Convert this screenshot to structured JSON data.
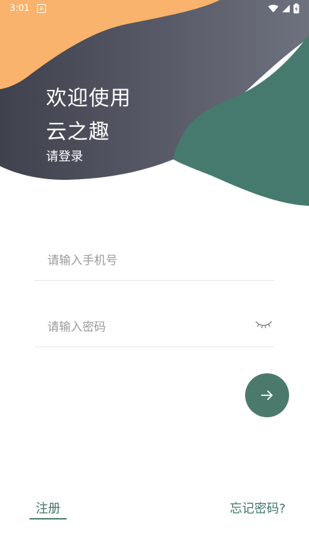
{
  "status_bar": {
    "time": "3:01",
    "notification_icon": "A",
    "icons": [
      "wifi-icon",
      "signal-icon",
      "battery-icon"
    ]
  },
  "header": {
    "welcome_line1": "欢迎使用",
    "welcome_line2": "云之趣",
    "subtitle": "请登录"
  },
  "form": {
    "phone_placeholder": "请输入手机号",
    "password_placeholder": "请输入密码",
    "password_visibility_icon": "eye-closed-icon",
    "submit_icon": "arrow-right-icon"
  },
  "footer": {
    "register_label": "注册",
    "forgot_label": "忘记密码?"
  },
  "colors": {
    "accent_green": "#4b7a6d",
    "header_dark": "#4a4c58",
    "header_orange": "#f9b36c",
    "link_text": "#3f7668"
  }
}
